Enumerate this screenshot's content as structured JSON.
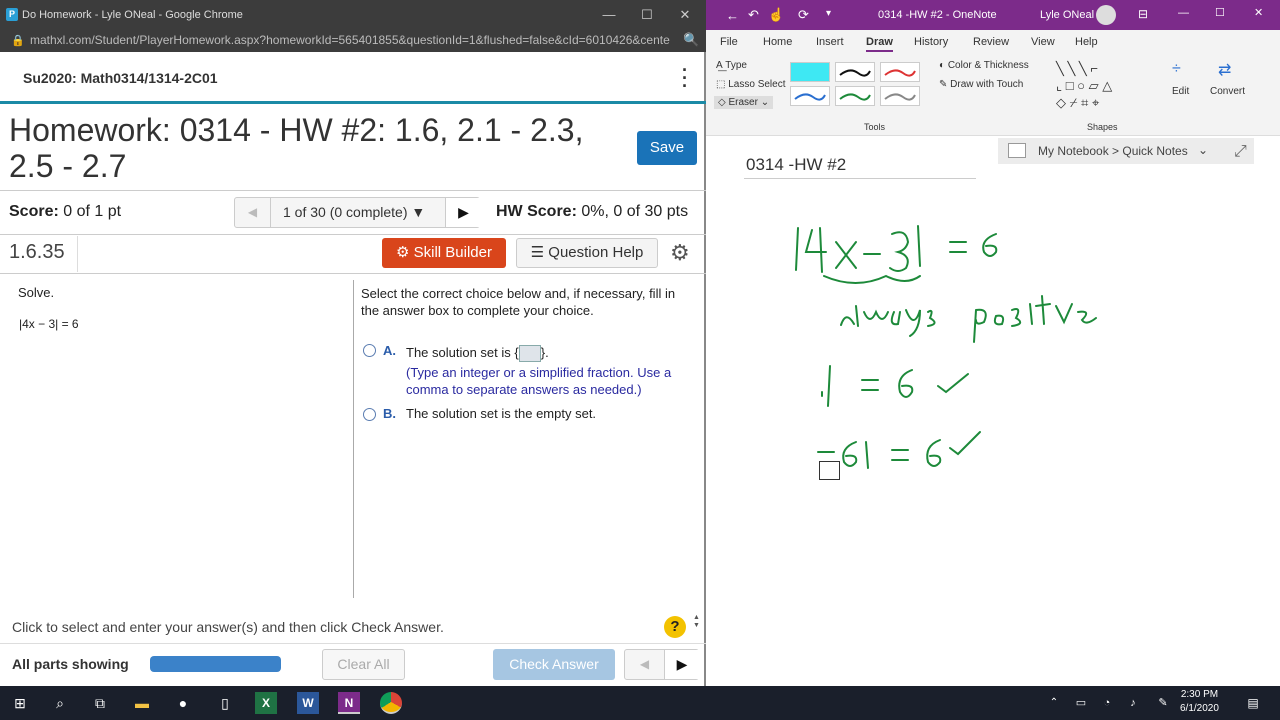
{
  "chrome": {
    "title": "Do Homework - Lyle ONeal - Google Chrome",
    "url": "mathxl.com/Student/PlayerHomework.aspx?homeworkId=565401855&questionId=1&flushed=false&cId=6010426&center...",
    "course": "Su2020: Math0314/1314-2C01",
    "hw_title": "Homework: 0314 - HW #2: 1.6, 2.1 - 2.3, 2.5 - 2.7",
    "save_label": "Save",
    "score_label": "Score:",
    "score_value": "0 of 1 pt",
    "nav_label": "1 of 30 (0 complete) ▼",
    "hw_score_label": "HW Score:",
    "hw_score_value": "0%, 0 of 30 pts",
    "question_number": "1.6.35",
    "skill_builder": "Skill Builder",
    "question_help": "Question Help",
    "solve": "Solve.",
    "equation": "|4x − 3| = 6",
    "instructions": "Select the correct choice below and, if necessary, fill in the answer box to complete your choice.",
    "option_a_label": "A.",
    "option_a_text_pre": "The solution set is {",
    "option_a_text_post": "}.",
    "option_a_hint": "(Type an integer or a simplified fraction. Use a comma to separate answers as needed.)",
    "option_b_label": "B.",
    "option_b_text": "The solution set is the empty set.",
    "footer_instr": "Click to select and enter your answer(s) and then click Check Answer.",
    "all_parts": "All parts showing",
    "progress": 1.0,
    "clear_all": "Clear All",
    "check_answer": "Check Answer"
  },
  "onenote": {
    "title": "0314 -HW #2 - OneNote",
    "user": "Lyle ONeal",
    "menu": [
      "File",
      "Home",
      "Insert",
      "Draw",
      "History",
      "Review",
      "View",
      "Help"
    ],
    "active_menu": "Draw",
    "tools": {
      "type": "Type",
      "lasso": "Lasso Select",
      "eraser": "Eraser",
      "color_thickness": "Color & Thickness",
      "draw_touch": "Draw with Touch",
      "group_tools": "Tools",
      "group_shapes": "Shapes",
      "edit": "Edit",
      "convert": "Convert"
    },
    "notebook": "My Notebook > Quick Notes",
    "page_title": "0314 -HW #2",
    "ink": {
      "line1": "|4x − 3| = 6",
      "line2": "always positive",
      "line3": "·| = 6 ✓",
      "line4": "−6| = 6 ✓"
    }
  },
  "taskbar": {
    "time": "2:30 PM",
    "date": "6/1/2020"
  }
}
